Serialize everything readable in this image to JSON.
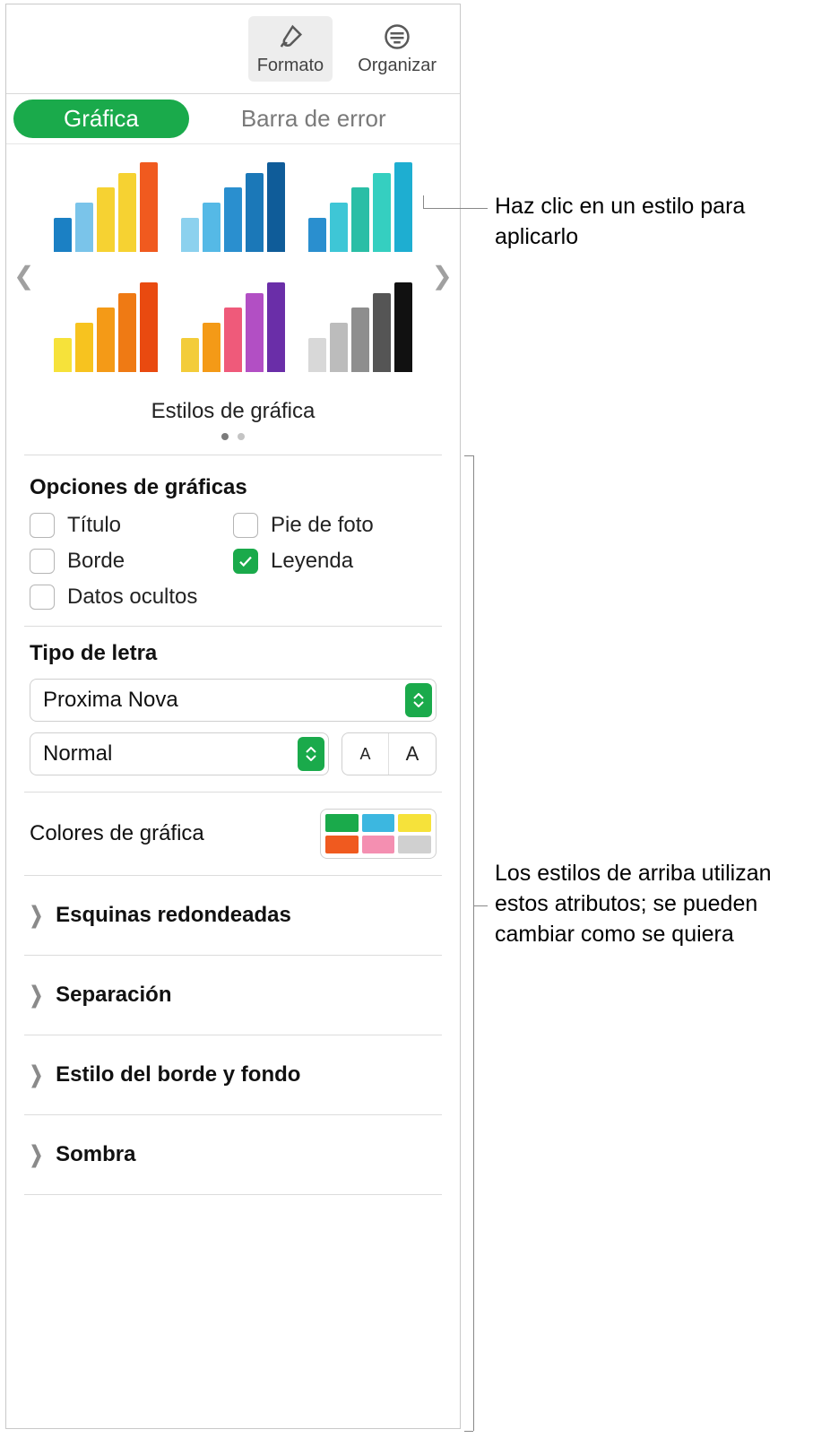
{
  "toolbar": {
    "format_label": "Formato",
    "organize_label": "Organizar"
  },
  "tabs": {
    "chart": "Gráfica",
    "error_bar": "Barra de error"
  },
  "styles": {
    "title": "Estilos de gráfica",
    "thumbs": [
      {
        "colors": [
          "#1b80c4",
          "#7ac4ea",
          "#f6d232",
          "#f6d232",
          "#f05a1f"
        ],
        "heights": [
          38,
          55,
          72,
          88,
          100
        ]
      },
      {
        "colors": [
          "#8cd1ee",
          "#55b9e6",
          "#2a8fcf",
          "#1b78b8",
          "#0f5c99"
        ],
        "heights": [
          38,
          55,
          72,
          88,
          100
        ]
      },
      {
        "colors": [
          "#2a8fcf",
          "#3ec6d6",
          "#2abea6",
          "#35cfc0",
          "#1eaed1"
        ],
        "heights": [
          38,
          55,
          72,
          88,
          100
        ]
      },
      {
        "colors": [
          "#f6e23a",
          "#f7c31f",
          "#f49a17",
          "#ef7a14",
          "#e94a10"
        ],
        "heights": [
          38,
          55,
          72,
          88,
          100
        ]
      },
      {
        "colors": [
          "#f3cc3a",
          "#f49a17",
          "#ef5a7a",
          "#b24fc4",
          "#6a2ea8"
        ],
        "heights": [
          38,
          55,
          72,
          88,
          100
        ]
      },
      {
        "colors": [
          "#d8d8d8",
          "#bcbcbc",
          "#8e8e8e",
          "#555555",
          "#111111"
        ],
        "heights": [
          38,
          55,
          72,
          88,
          100
        ]
      }
    ]
  },
  "options": {
    "heading": "Opciones de gráficas",
    "items": [
      {
        "key": "title",
        "label": "Título",
        "checked": false
      },
      {
        "key": "caption",
        "label": "Pie de foto",
        "checked": false
      },
      {
        "key": "border",
        "label": "Borde",
        "checked": false
      },
      {
        "key": "legend",
        "label": "Leyenda",
        "checked": true
      },
      {
        "key": "hidden",
        "label": "Datos ocultos",
        "checked": false
      }
    ]
  },
  "font": {
    "heading": "Tipo de letra",
    "family": "Proxima Nova",
    "weight": "Normal",
    "smaller": "A",
    "larger": "A"
  },
  "chart_colors": {
    "label": "Colores de gráfica",
    "palette": [
      "#1aaa4b",
      "#3cb7e0",
      "#f6e23a",
      "#f05a1f",
      "#f48fb1",
      "#d0d0d0"
    ]
  },
  "disclosures": {
    "rounded": "Esquinas redondeadas",
    "separation": "Separación",
    "border_bg": "Estilo del borde y fondo",
    "shadow": "Sombra"
  },
  "callouts": {
    "top": "Haz clic en un estilo para aplicarlo",
    "bottom": "Los estilos de arriba utilizan estos atributos; se pueden cambiar como se quiera"
  }
}
